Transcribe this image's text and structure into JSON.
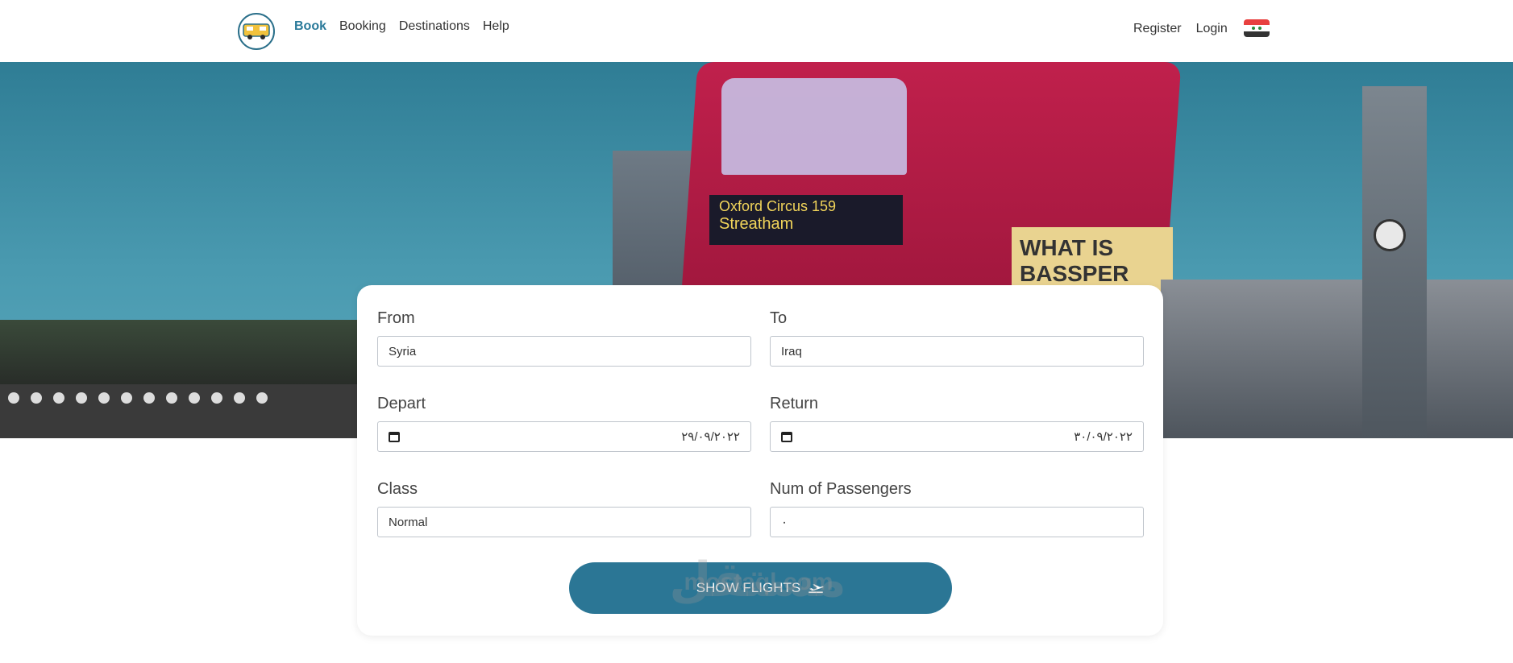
{
  "nav": {
    "links": [
      {
        "label": "Book",
        "active": true
      },
      {
        "label": "Booking",
        "active": false
      },
      {
        "label": "Destinations",
        "active": false
      },
      {
        "label": "Help",
        "active": false
      }
    ],
    "register_label": "Register",
    "login_label": "Login",
    "logo_icon": "bus-logo-icon",
    "flag_icon": "syria-flag-icon"
  },
  "hero": {
    "bus_dest_line1": "Oxford Circus 159",
    "bus_dest_line2": "Streatham",
    "bus_ad_text": "WHAT IS BASSPER"
  },
  "form": {
    "from_label": "From",
    "from_value": "Syria",
    "to_label": "To",
    "to_value": "Iraq",
    "depart_label": "Depart",
    "depart_value": "٢٩/٠٩/٢٠٢٢",
    "return_label": "Return",
    "return_value": "٣٠/٠٩/٢٠٢٢",
    "class_label": "Class",
    "class_value": "Normal",
    "passengers_label": "Num of Passengers",
    "passengers_value": "٠",
    "submit_label": "SHOW FLIGHTS"
  },
  "watermark": {
    "text": "mostaql.com",
    "arabic": "مستقل"
  },
  "colors": {
    "accent": "#2b7695",
    "active_nav": "#2a7a9a"
  }
}
